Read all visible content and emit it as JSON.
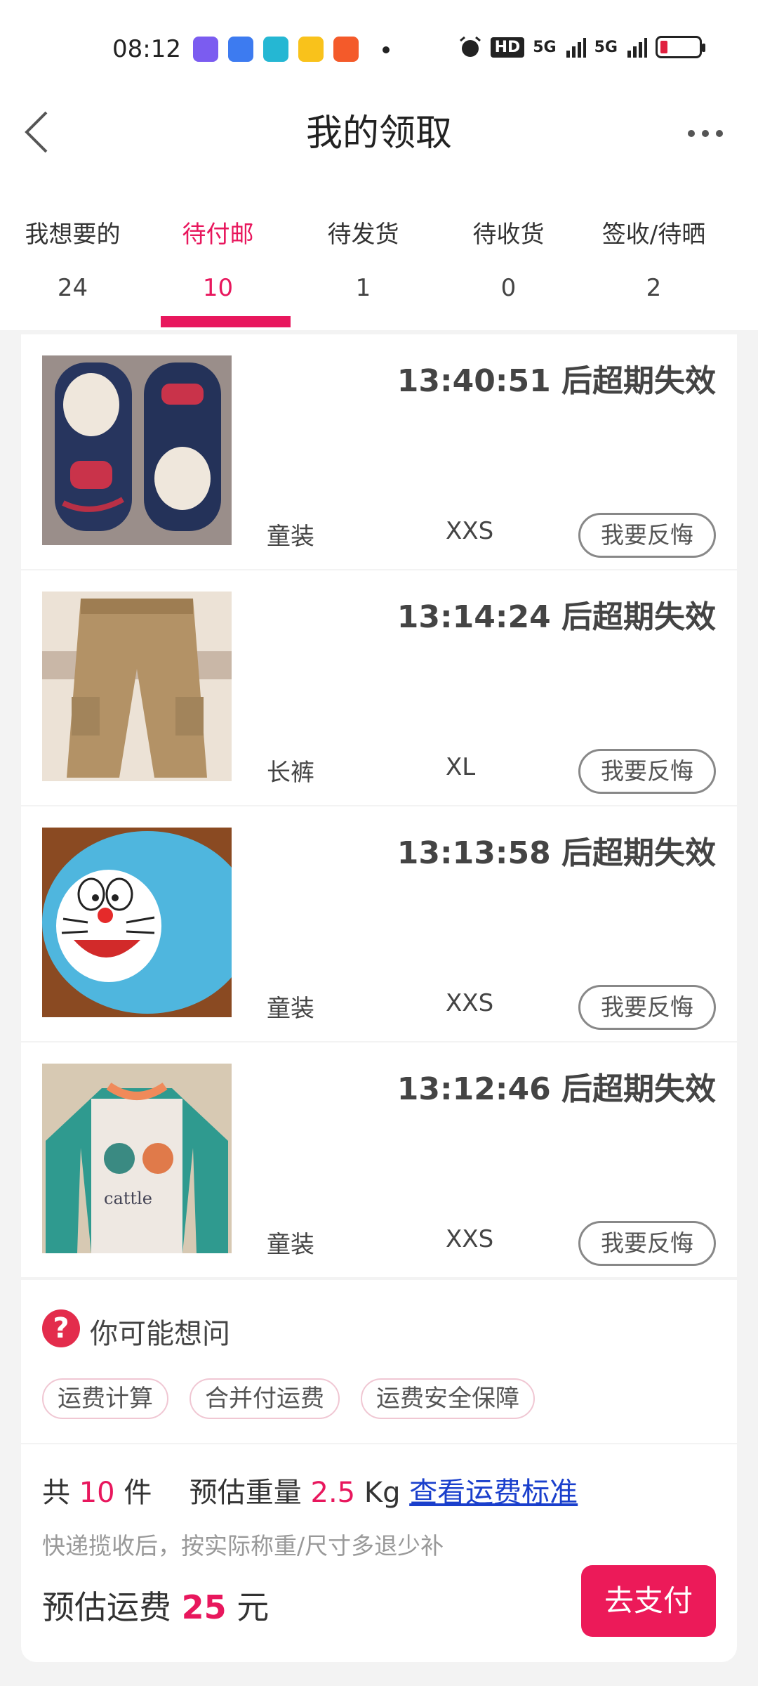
{
  "status_bar": {
    "time": "08:12",
    "app_icons": [
      "video-app-icon",
      "tieba-icon",
      "video-play-icon",
      "meituan-icon",
      "kuaishou-icon"
    ],
    "right_text": "HD",
    "network": "5G"
  },
  "nav": {
    "title": "我的领取"
  },
  "tabs": [
    {
      "label": "我想要的",
      "count": "24",
      "active": false
    },
    {
      "label": "待付邮",
      "count": "10",
      "active": true
    },
    {
      "label": "待发货",
      "count": "1",
      "active": false
    },
    {
      "label": "待收货",
      "count": "0",
      "active": false
    },
    {
      "label": "签收/待晒",
      "count": "2",
      "active": false
    }
  ],
  "items": [
    {
      "expire_text": "13:40:51 后超期失效",
      "category": "童装",
      "size": "XXS",
      "regret_label": "我要反悔",
      "image": "shoes"
    },
    {
      "expire_text": "13:14:24 后超期失效",
      "category": "长裤",
      "size": "XL",
      "regret_label": "我要反悔",
      "image": "pants"
    },
    {
      "expire_text": "13:13:58 后超期失效",
      "category": "童装",
      "size": "XXS",
      "regret_label": "我要反悔",
      "image": "doraemon-bag"
    },
    {
      "expire_text": "13:12:46 后超期失效",
      "category": "童装",
      "size": "XXS",
      "regret_label": "我要反悔",
      "image": "shirt"
    }
  ],
  "faq": {
    "title": "你可能想问",
    "icon_symbol": "?",
    "chips": [
      "运费计算",
      "合并付运费",
      "运费安全保障"
    ]
  },
  "summary": {
    "total_prefix": "共",
    "total_count": "10",
    "total_unit": "件",
    "weight_label": "预估重量",
    "weight_value": "2.5",
    "weight_unit": "Kg",
    "standard_link": "查看运费标准",
    "hint": "快递揽收后，按实际称重/尺寸多退少补",
    "fee_label": "预估运费",
    "fee_value": "25",
    "fee_unit": "元",
    "pay_button": "去支付"
  },
  "colors": {
    "accent": "#e8175d",
    "link": "#1a3fcc"
  }
}
